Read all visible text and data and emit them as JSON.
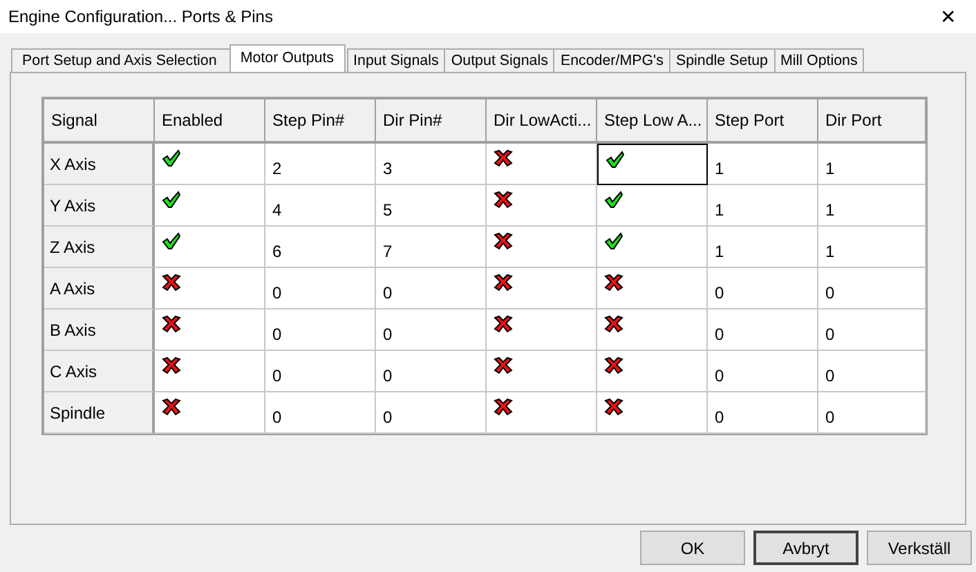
{
  "window": {
    "title": "Engine Configuration... Ports & Pins",
    "close": "✕"
  },
  "tabs": [
    {
      "label": "Port Setup and Axis Selection",
      "selected": false
    },
    {
      "label": "Motor Outputs",
      "selected": true
    },
    {
      "label": "Input Signals",
      "selected": false
    },
    {
      "label": "Output Signals",
      "selected": false
    },
    {
      "label": "Encoder/MPG's",
      "selected": false
    },
    {
      "label": "Spindle Setup",
      "selected": false
    },
    {
      "label": "Mill Options",
      "selected": false
    }
  ],
  "table": {
    "columns": [
      {
        "label": "Signal",
        "kind": "header"
      },
      {
        "label": "Enabled",
        "kind": "flag"
      },
      {
        "label": "Step Pin#",
        "kind": "text"
      },
      {
        "label": "Dir Pin#",
        "kind": "text"
      },
      {
        "label": "Dir LowActi...",
        "kind": "flag"
      },
      {
        "label": "Step Low A...",
        "kind": "flag"
      },
      {
        "label": "Step Port",
        "kind": "text"
      },
      {
        "label": "Dir Port",
        "kind": "text"
      }
    ],
    "rows": [
      {
        "cells": [
          "X Axis",
          {
            "checked": true,
            "focused": false
          },
          "2",
          "3",
          {
            "checked": false,
            "focused": false
          },
          {
            "checked": true,
            "focused": true
          },
          "1",
          "1"
        ]
      },
      {
        "cells": [
          "Y Axis",
          {
            "checked": true,
            "focused": false
          },
          "4",
          "5",
          {
            "checked": false,
            "focused": false
          },
          {
            "checked": true,
            "focused": false
          },
          "1",
          "1"
        ]
      },
      {
        "cells": [
          "Z Axis",
          {
            "checked": true,
            "focused": false
          },
          "6",
          "7",
          {
            "checked": false,
            "focused": false
          },
          {
            "checked": true,
            "focused": false
          },
          "1",
          "1"
        ]
      },
      {
        "cells": [
          "A Axis",
          {
            "checked": false,
            "focused": false
          },
          "0",
          "0",
          {
            "checked": false,
            "focused": false
          },
          {
            "checked": false,
            "focused": false
          },
          "0",
          "0"
        ]
      },
      {
        "cells": [
          "B Axis",
          {
            "checked": false,
            "focused": false
          },
          "0",
          "0",
          {
            "checked": false,
            "focused": false
          },
          {
            "checked": false,
            "focused": false
          },
          "0",
          "0"
        ]
      },
      {
        "cells": [
          "C Axis",
          {
            "checked": false,
            "focused": false
          },
          "0",
          "0",
          {
            "checked": false,
            "focused": false
          },
          {
            "checked": false,
            "focused": false
          },
          "0",
          "0"
        ]
      },
      {
        "cells": [
          "Spindle",
          {
            "checked": false,
            "focused": false
          },
          "0",
          "0",
          {
            "checked": false,
            "focused": false
          },
          {
            "checked": false,
            "focused": false
          },
          "0",
          "0"
        ]
      }
    ]
  },
  "buttons": [
    {
      "label": "OK",
      "default": false
    },
    {
      "label": "Avbryt",
      "default": true
    },
    {
      "label": "Verkställ",
      "default": false
    }
  ]
}
